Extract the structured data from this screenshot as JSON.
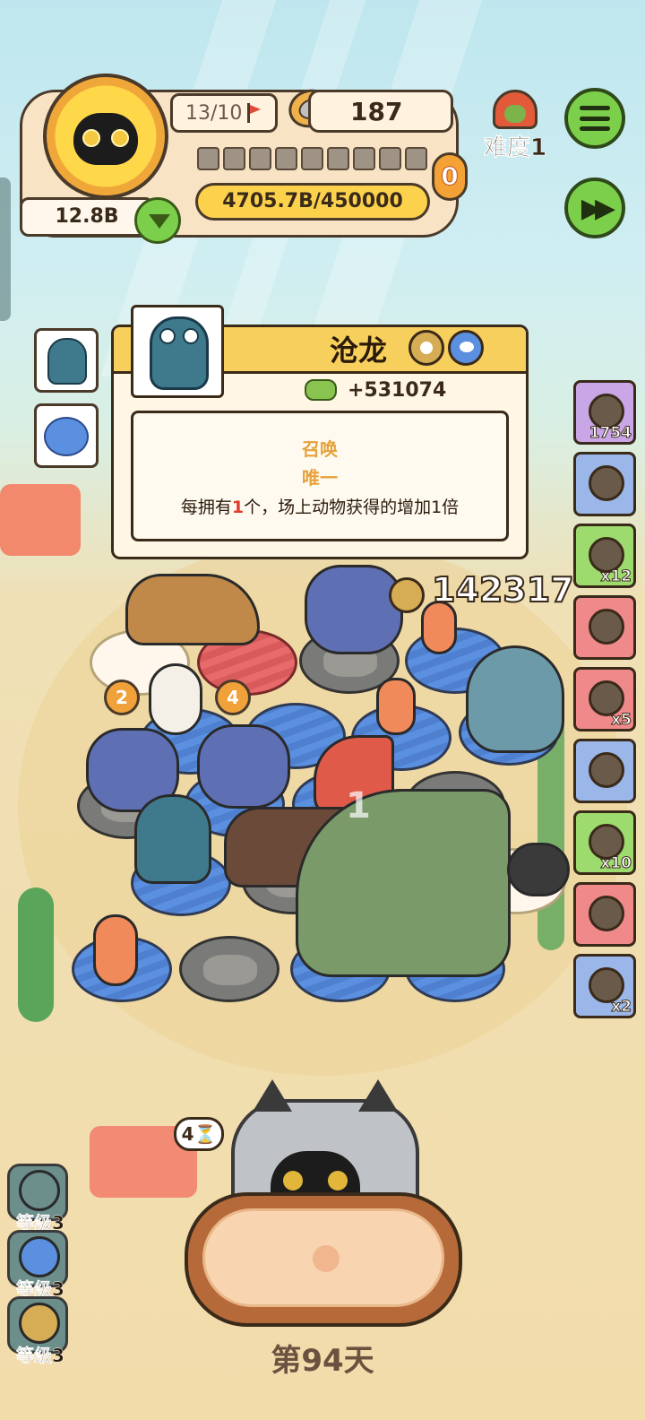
{
  "hud": {
    "cat_count": "13/10",
    "coins": "187",
    "difficulty": "难度1",
    "progress": "4705.7B/450000",
    "money": "12.8B",
    "pending_badge": "0",
    "slot_count": 9
  },
  "popup": {
    "title": "沧龙",
    "bonus": "+531074",
    "tag_1": "召唤",
    "tag_2": "唯一",
    "desc_before": "每拥有",
    "desc_num": "1",
    "desc_after": "个，场上动物获得的增加1倍"
  },
  "skills": [
    {
      "name": "stone-egg-skill",
      "count": "1754",
      "color": "#c9a7e6"
    },
    {
      "name": "camera-skill",
      "count": "",
      "color": "#9bb6e8"
    },
    {
      "name": "tent-skill",
      "count": "x12",
      "color": "#9edb6e"
    },
    {
      "name": "plus-two-skill",
      "count": "",
      "color": "#f08a8a"
    },
    {
      "name": "bag-skill",
      "count": "x5",
      "color": "#f08a8a"
    },
    {
      "name": "jar-skill",
      "count": "",
      "color": "#9bb6e8"
    },
    {
      "name": "nest-skill",
      "count": "x10",
      "color": "#9edb6e"
    },
    {
      "name": "fire-stone-skill",
      "count": "",
      "color": "#f08a8a"
    },
    {
      "name": "donut-skill",
      "count": "x2",
      "color": "#9bb6e8"
    }
  ],
  "board": {
    "score_popup": "142317",
    "badge_a": "2",
    "badge_b": "4",
    "faded_number": "1"
  },
  "bottom": {
    "timer": "4",
    "day": "第94天",
    "levels": [
      {
        "label": "等级3",
        "color": "#6c8f8c"
      },
      {
        "label": "等级3",
        "color": "#5b8fe0"
      },
      {
        "label": "等级3",
        "color": "#d6ad55"
      }
    ]
  }
}
